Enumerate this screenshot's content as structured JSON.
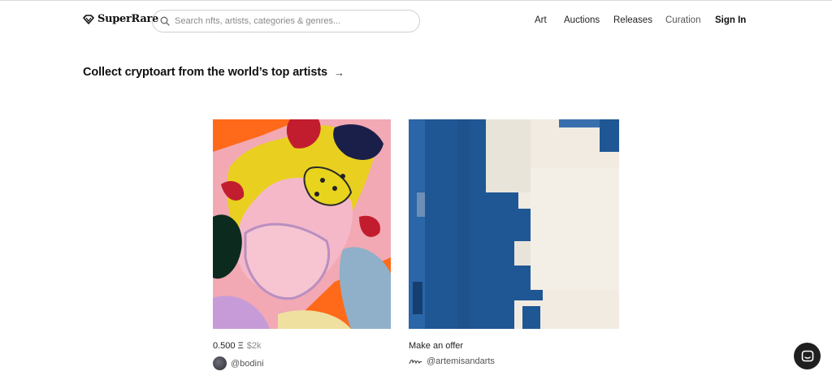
{
  "header": {
    "logo_text": "SuperRare",
    "search_placeholder": "Search nfts, artists, categories & genres...",
    "nav": {
      "art": "Art",
      "auctions": "Auctions",
      "releases": "Releases",
      "curation": "Curation",
      "sign_in": "Sign In"
    }
  },
  "main": {
    "headline": "Collect cryptoart from the world’s top artists",
    "headline_arrow": "→",
    "cards": [
      {
        "price_eth": "0.500 Ξ",
        "price_usd": "$2k",
        "artist": "@bodini",
        "artwork_icon": "abstract-colorful-artwork"
      },
      {
        "status": "Make an offer",
        "artist": "@artemisandarts",
        "artwork_icon": "blue-white-abstract-artwork"
      }
    ]
  },
  "icons": {
    "logo": "diamond-icon",
    "search": "search-icon",
    "chat": "chat-icon"
  },
  "colors": {
    "text": "#111111",
    "muted": "#8a8a8a",
    "chat_bg": "#1f1f1f"
  }
}
